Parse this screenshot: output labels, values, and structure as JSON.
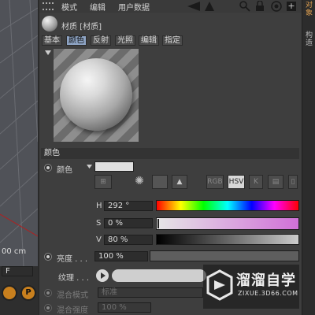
{
  "menu": {
    "item1": "模式",
    "item2": "编辑",
    "item3": "用户数据"
  },
  "header": {
    "title": "材质 [材质]"
  },
  "tabs": [
    "基本",
    "颜色",
    "反射",
    "光照",
    "编辑",
    "指定"
  ],
  "section": {
    "title": "颜色"
  },
  "color": {
    "label": "颜色",
    "swatch": "#e0e0e0"
  },
  "toolbar": {
    "rgb": "RGB",
    "hsv": "HSV",
    "k": "K"
  },
  "hsv": {
    "h_label": "H",
    "h_value": "292 °",
    "s_label": "S",
    "s_value": "0 %",
    "v_label": "V",
    "v_value": "80 %"
  },
  "brightness": {
    "label": "亮度 . . .",
    "value": "100 %"
  },
  "texture": {
    "label": "纹理 . . ."
  },
  "blend": {
    "mode_label": "混合模式",
    "mode_value": "标准",
    "strength_label": "混合强度",
    "strength_value": "100 %"
  },
  "viewport": {
    "unit_text": "00 cm",
    "field_text": "F"
  },
  "rightstrip": {
    "tab1": "对象",
    "tab2": "构造"
  },
  "watermark": {
    "name": "溜溜自学",
    "url": "ZIXUE.3D66.COM"
  },
  "colors": {
    "accent_tab": "#8ea4c4",
    "panel": "#3e3e3e"
  }
}
